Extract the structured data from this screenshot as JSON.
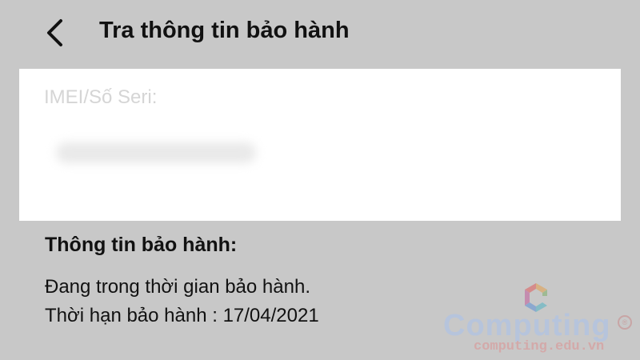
{
  "header": {
    "title": "Tra thông tin bảo hành",
    "back_icon": "chevron-left-icon"
  },
  "form": {
    "imei_label": "IMEI/Số Seri:",
    "imei_value": ""
  },
  "warranty": {
    "section_title": "Thông tin bảo hành:",
    "status_text": "Đang trong thời gian bảo hành.",
    "expiry_text": "Thời hạn bảo hành : 17/04/2021"
  },
  "watermark": {
    "brand": "Computing",
    "domain": "computing.edu.vn",
    "registered_mark": "®"
  },
  "colors": {
    "background": "#c8c8c8",
    "card": "#ffffff",
    "label_muted": "#d5d5d5",
    "text": "#111111"
  }
}
